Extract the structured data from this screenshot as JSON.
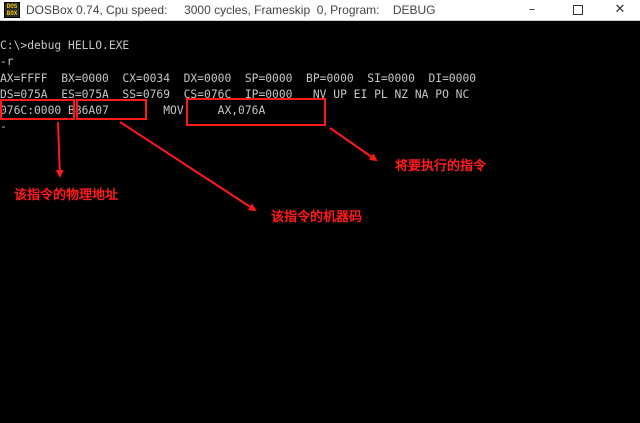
{
  "window": {
    "title": "DOSBox 0.74, Cpu speed:     3000 cycles, Frameskip  0, Program:    DEBUG",
    "icon_lines": [
      "DOS",
      "BOX"
    ],
    "buttons": {
      "minimize": "–",
      "close": "✕"
    }
  },
  "console": {
    "lines": [
      "C:\\>debug HELLO.EXE",
      "-r",
      "AX=FFFF  BX=0000  CX=0034  DX=0000  SP=0000  BP=0000  SI=0000  DI=0000",
      "DS=075A  ES=075A  SS=0769  CS=076C  IP=0000   NV UP EI PL NZ NA PO NC",
      "076C:0000 B86A07        MOV     AX,076A",
      "-"
    ]
  },
  "annotations": {
    "physical_address": "该指令的物理地址",
    "machine_code": "该指令的机器码",
    "instruction": "将要执行的指令",
    "color": "#ff1a1a"
  }
}
